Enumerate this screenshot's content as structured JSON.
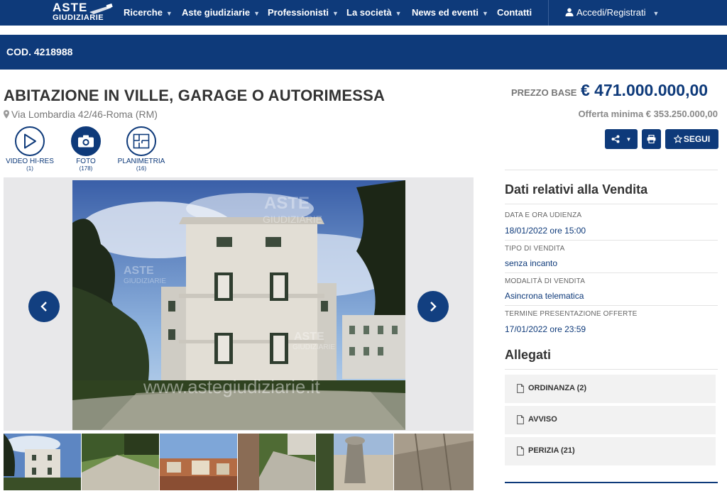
{
  "nav": {
    "logo_top": "ASTE",
    "logo_bottom": "GIUDIZIARIE",
    "items": [
      {
        "label": "Ricerche",
        "chevron": true
      },
      {
        "label": "Aste giudiziarie",
        "chevron": true
      },
      {
        "label": "Professionisti",
        "chevron": true
      },
      {
        "label": "La società",
        "chevron": true
      },
      {
        "label": "News ed eventi",
        "chevron": true
      },
      {
        "label": "Contatti",
        "chevron": false
      }
    ],
    "login": "Accedi/Registrati"
  },
  "code_bar": "COD. 4218988",
  "listing": {
    "title": "ABITAZIONE IN VILLE, GARAGE O AUTORIMESSA",
    "address": "Via Lombardia 42/46-Roma (RM)",
    "price_label": "PREZZO BASE",
    "price": "€ 471.000.000,00",
    "offer": "Offerta minima € 353.250.000,00"
  },
  "actions": {
    "follow_label": "SEGUI"
  },
  "media": [
    {
      "label": "VIDEO HI-RES",
      "count": "(1)",
      "icon": "play-icon"
    },
    {
      "label": "FOTO",
      "count": "(178)",
      "icon": "camera-icon"
    },
    {
      "label": "PLANIMETRIA",
      "count": "(16)",
      "icon": "floorplan-icon"
    }
  ],
  "photo": {
    "watermark": "www.astegiudiziarie.it"
  },
  "sale": {
    "heading": "Dati relativi alla Vendita",
    "rows": [
      {
        "label": "DATA E ORA UDIENZA",
        "value": "18/01/2022 ore 15:00"
      },
      {
        "label": "TIPO DI VENDITA",
        "value": "senza incanto"
      },
      {
        "label": "MODALITÀ DI VENDITA",
        "value": "Asincrona telematica"
      },
      {
        "label": "TERMINE PRESENTAZIONE OFFERTE",
        "value": "17/01/2022 ore 23:59"
      }
    ]
  },
  "attachments": {
    "heading": "Allegati",
    "items": [
      {
        "label": "ORDINANZA (2)"
      },
      {
        "label": "AVVISO"
      },
      {
        "label": "PERIZIA (21)"
      }
    ]
  },
  "colors": {
    "brand": "#0e3a7a",
    "text": "#333333",
    "muted": "#777777"
  }
}
